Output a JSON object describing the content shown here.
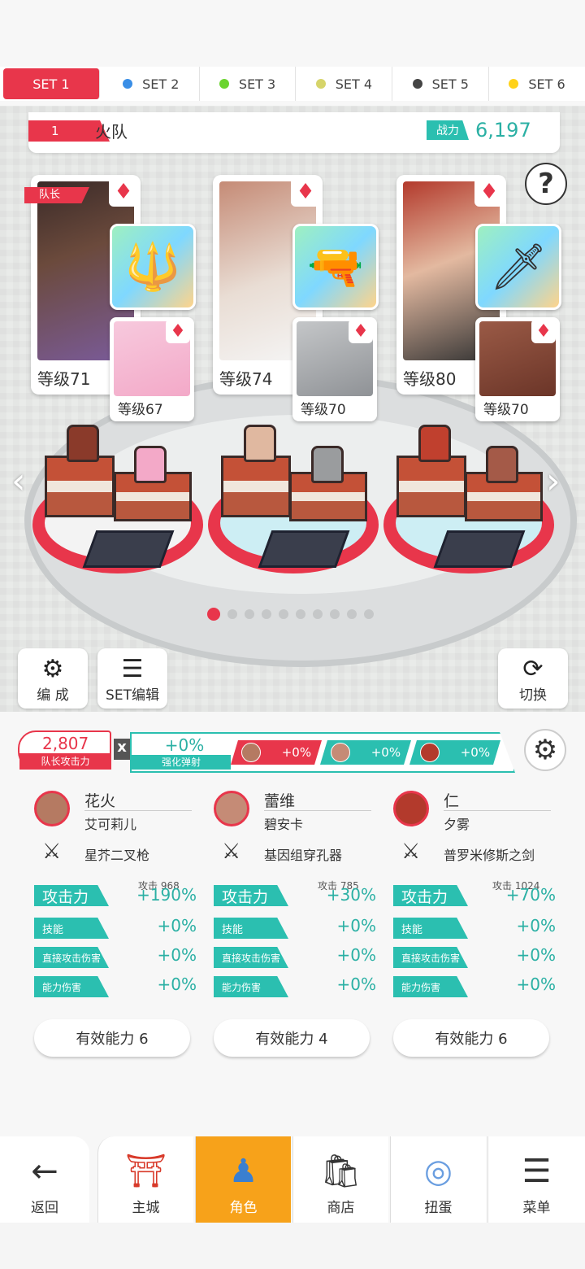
{
  "tabs": [
    {
      "label": "SET 1",
      "color": "",
      "active": true
    },
    {
      "label": "SET 2",
      "color": "#3a8ee6"
    },
    {
      "label": "SET 3",
      "color": "#6bd430"
    },
    {
      "label": "SET 4",
      "color": "#d6d46a"
    },
    {
      "label": "SET 5",
      "color": "#444444"
    },
    {
      "label": "SET 6",
      "color": "#ffd21a"
    }
  ],
  "team": {
    "number": "1",
    "name": "火队",
    "power_label": "战力",
    "power": "6,197"
  },
  "help": "?",
  "captain_label": "队长",
  "cards": [
    {
      "level": "等级71",
      "sub_level": "等级67",
      "portrait_color": "#6b4a3c",
      "sub_color": "#f3a9c8"
    },
    {
      "level": "等级74",
      "sub_level": "等级70",
      "portrait_color": "#b07e6e",
      "sub_color": "#8f9296"
    },
    {
      "level": "等级80",
      "sub_level": "等级70",
      "portrait_color": "#b33a2c",
      "sub_color": "#7a4032"
    }
  ],
  "suit_icon": "♦",
  "weapon_icons": [
    "🔱",
    "🔫",
    "🗡"
  ],
  "buttons": {
    "formation": "编 成",
    "set_edit": "SET编辑",
    "switch": "切换"
  },
  "stats_header": {
    "leader_attack": "2,807",
    "leader_attack_label": "队长攻击力",
    "multiply": "x",
    "boost_value": "+0%",
    "boost_label": "强化弹射",
    "member_boosts": [
      "+0%",
      "+0%",
      "+0%"
    ]
  },
  "members": [
    {
      "name": "花火",
      "partner": "艾可莉儿",
      "weapon": "星芥二叉枪",
      "attack_label": "攻击力",
      "attack_base": "攻击 968",
      "attack": "+190%",
      "skill_label": "技能",
      "skill": "+0%",
      "direct_label": "直接攻击伤害",
      "direct": "+0%",
      "ability_label": "能力伤害",
      "ability": "+0%",
      "effective": "有效能力 6"
    },
    {
      "name": "蕾维",
      "partner": "碧安卡",
      "weapon": "基因组穿孔器",
      "attack_label": "攻击力",
      "attack_base": "攻击 785",
      "attack": "+30%",
      "skill_label": "技能",
      "skill": "+0%",
      "direct_label": "直接攻击伤害",
      "direct": "+0%",
      "ability_label": "能力伤害",
      "ability": "+0%",
      "effective": "有效能力 4"
    },
    {
      "name": "仁",
      "partner": "夕雾",
      "weapon": "普罗米修斯之剑",
      "attack_label": "攻击力",
      "attack_base": "攻击 1024",
      "attack": "+70%",
      "skill_label": "技能",
      "skill": "+0%",
      "direct_label": "直接攻击伤害",
      "direct": "+0%",
      "ability_label": "能力伤害",
      "ability": "+0%",
      "effective": "有效能力 6"
    }
  ],
  "nav": [
    {
      "label": "返回",
      "icon": "←"
    },
    {
      "label": "主城",
      "icon": "⛩"
    },
    {
      "label": "角色",
      "icon": "♟",
      "active": true
    },
    {
      "label": "商店",
      "icon": "🛍"
    },
    {
      "label": "扭蛋",
      "icon": "◎"
    },
    {
      "label": "菜单",
      "icon": "☰"
    }
  ],
  "page_dots": {
    "count": 10,
    "active": 0
  }
}
